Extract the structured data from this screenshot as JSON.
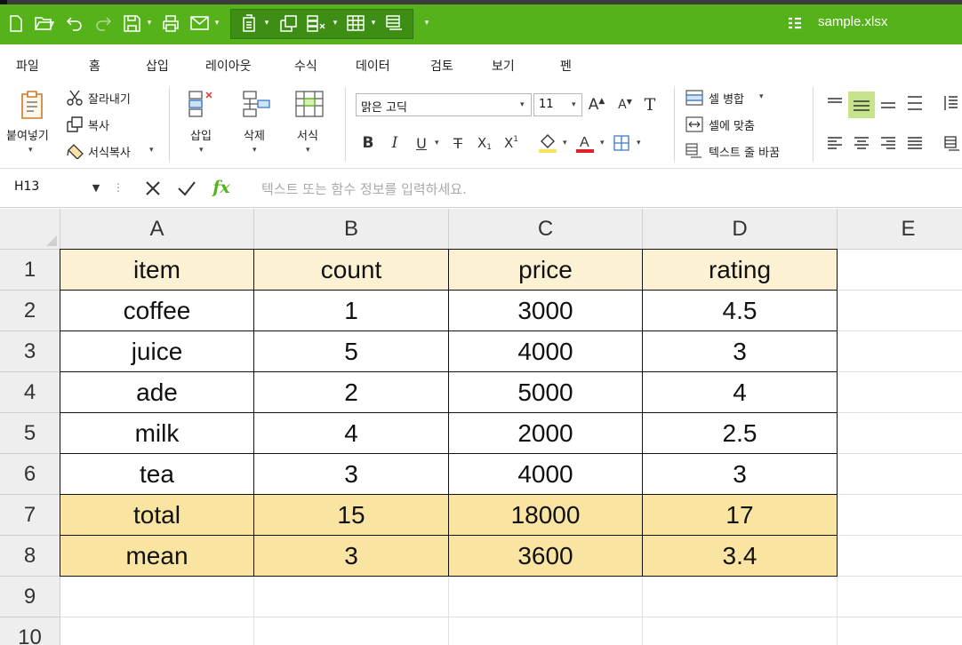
{
  "window": {
    "filename": "sample.xlsx"
  },
  "menu": {
    "tabs": [
      "파일",
      "홈",
      "삽입",
      "레이아웃",
      "수식",
      "데이터",
      "검토",
      "보기",
      "펜"
    ],
    "active": "홈"
  },
  "ribbon": {
    "paste_label": "붙여넣기",
    "cut_label": "잘라내기",
    "copy_label": "복사",
    "format_painter_label": "서식복사",
    "insert_label": "삽입",
    "delete_label": "삭제",
    "format_label": "서식",
    "font_name": "맑은 고딕",
    "font_size": "11",
    "merge_label": "셀 병합",
    "fit_label": "셀에 맞춤",
    "wrap_label": "텍스트 줄 바꿈"
  },
  "formula_bar": {
    "name_box": "H13",
    "placeholder": "텍스트 또는 함수 정보를 입력하세요."
  },
  "sheet": {
    "columns": [
      "A",
      "B",
      "C",
      "D",
      "E"
    ],
    "rows": [
      "1",
      "2",
      "3",
      "4",
      "5",
      "6",
      "7",
      "8",
      "9",
      "10"
    ],
    "header": [
      "item",
      "count",
      "price",
      "rating"
    ],
    "data": [
      [
        "coffee",
        "1",
        "3000",
        "4.5"
      ],
      [
        "juice",
        "5",
        "4000",
        "3"
      ],
      [
        "ade",
        "2",
        "5000",
        "4"
      ],
      [
        "milk",
        "4",
        "2000",
        "2.5"
      ],
      [
        "tea",
        "3",
        "4000",
        "3"
      ],
      [
        "total",
        "15",
        "18000",
        "17"
      ],
      [
        "mean",
        "3",
        "3600",
        "3.4"
      ]
    ]
  },
  "colors": {
    "accent": "#56b21b",
    "header_fill": "#fdf1d4",
    "summary_fill": "#f9e4a2"
  }
}
